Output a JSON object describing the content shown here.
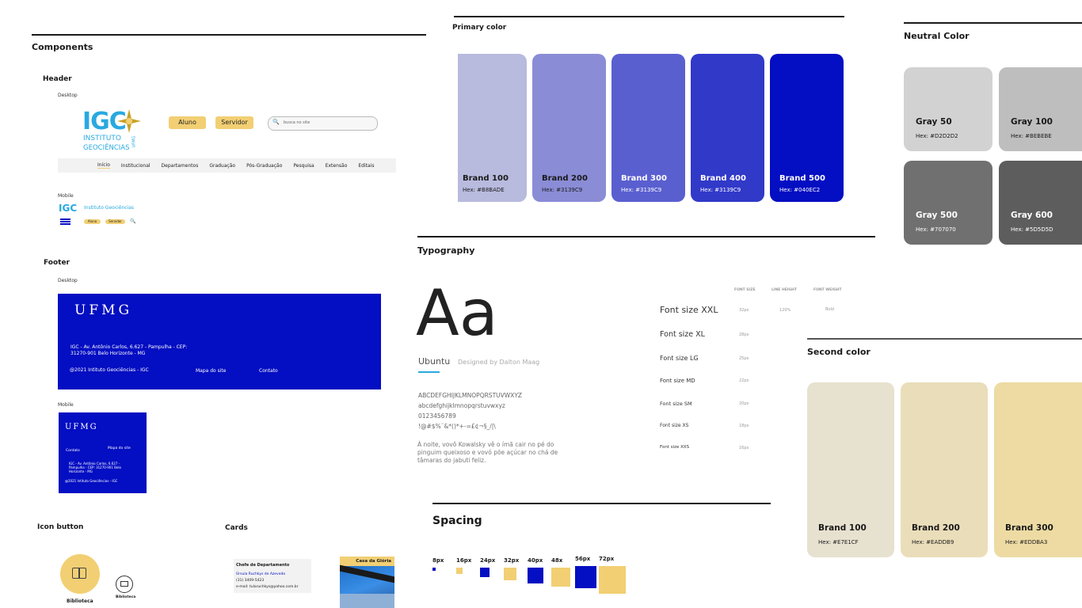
{
  "components": {
    "title": "Components",
    "header": {
      "title": "Header",
      "desktop_label": "Desktop",
      "mobile_label": "Mobile",
      "logo_lines": [
        "IGC",
        "INSTITUTO",
        "GEOCIÊNCIAS",
        "UFMG"
      ],
      "buttons": [
        "Aluno",
        "Servidor"
      ],
      "search_placeholder": "busca no site",
      "nav": [
        "Início",
        "Institucional",
        "Departamentos",
        "Graduação",
        "Pós-Graduação",
        "Pesquisa",
        "Extensão",
        "Editais"
      ],
      "mobile_title": "Instituto Geociências",
      "mobile_buttons": [
        "Aluno",
        "Servidor"
      ]
    },
    "footer": {
      "title": "Footer",
      "desktop_label": "Desktop",
      "mobile_label": "Mobile",
      "logo": "UFMG",
      "address": "IGC - Av. Antônio Carlos, 6.627 - Pampulha - CEP: 31270-901 Belo Horizonte - MG",
      "copyright": "@2021 Intituto Geociências - IGC",
      "link_map": "Mapa do site",
      "link_contact": "Contato",
      "mobile_contact": "Contato",
      "mobile_map": "Mapa do site",
      "mobile_address": "IGC - Av. Antônio Carlos, 6.627 - Pampulha - CEP: 31270-901 Belo Horizonte - MG",
      "mobile_copyright": "@2021 Intituto Geociências - IGC"
    },
    "icon_button": {
      "title": "Icon button",
      "large_label": "Biblioteca",
      "small_label": "Biblioteca"
    },
    "cards": {
      "title": "Cards",
      "card1_title": "Chefe de Departamento",
      "card1_name": "Úrsula Ruchkys de Azevedo",
      "card1_phone": "(31) 3409-5423",
      "card1_email": "e-mail: tularuchkys@yahoo.com.br",
      "card2_title": "Casa da Glória"
    }
  },
  "primary_color": {
    "title": "Primary color",
    "swatches": [
      {
        "name": "Brand 100",
        "hex_label": "Hex: #B8BADE",
        "color": "#B8BADE"
      },
      {
        "name": "Brand 200",
        "hex_label": "Hex: #3139C9",
        "color": "#8A8CD6"
      },
      {
        "name": "Brand 300",
        "hex_label": "Hex: #3139C9",
        "color": "#5A5FD0"
      },
      {
        "name": "Brand 400",
        "hex_label": "Hex: #3139C9",
        "color": "#3139C9"
      },
      {
        "name": "Brand 500",
        "hex_label": "Hex: #040EC2",
        "color": "#040EC2"
      }
    ]
  },
  "neutral_color": {
    "title": "Neutral Color",
    "swatches": [
      {
        "name": "Gray 50",
        "hex_label": "Hex: #D2D2D2",
        "color": "#D2D2D2"
      },
      {
        "name": "Gray 100",
        "hex_label": "Hex: #BEBEBE",
        "color": "#BEBEBE"
      },
      {
        "name": "Gray 500",
        "hex_label": "Hex: #707070",
        "color": "#707070"
      },
      {
        "name": "Gray 600",
        "hex_label": "Hex: #5D5D5D",
        "color": "#5D5D5D"
      }
    ]
  },
  "typography": {
    "title": "Typography",
    "sample_glyph": "Aa",
    "font_name": "Ubuntu",
    "designer": "Designed by Dalton Maag",
    "uppercase": "ABCDEFGHIJKLMNOPQRSTUVWXYZ",
    "lowercase": "abcdefghijklmnopqrstuvwxyz",
    "digits": "0123456789",
    "symbols": "!@#$%¨&*()*+-=£¢¬§_/|\\",
    "pangram": "À noite, vovô Kowalsky vê o ímã cair no pé do pinguim queixoso e vovó põe açúcar no chá de tâmaras do jabuti feliz.",
    "col_headers": [
      "FONT SIZE",
      "LINE HEIGHT",
      "FONT WEIGHT"
    ],
    "line_height": "120%",
    "font_weight": "Bold",
    "sizes": [
      {
        "name": "Font size XXL",
        "size": "32px"
      },
      {
        "name": "Font size XL",
        "size": "28px"
      },
      {
        "name": "Font size LG",
        "size": "25px"
      },
      {
        "name": "Font size MD",
        "size": "22px"
      },
      {
        "name": "Font size SM",
        "size": "20px"
      },
      {
        "name": "Font size XS",
        "size": "18px"
      },
      {
        "name": "Font size XXS",
        "size": "16px"
      }
    ]
  },
  "second_color": {
    "title": "Second color",
    "swatches": [
      {
        "name": "Brand 100",
        "hex_label": "Hex: #E7E1CF",
        "color": "#E7E1CF"
      },
      {
        "name": "Brand 200",
        "hex_label": "Hex: #EADDB9",
        "color": "#EADDB9"
      },
      {
        "name": "Brand 300",
        "hex_label": "Hex: #EDDBA3",
        "color": "#EDDBA3"
      }
    ]
  },
  "spacing": {
    "title": "Spacing",
    "items": [
      "8px",
      "16px",
      "24px",
      "32px",
      "40px",
      "48x",
      "56px",
      "72px"
    ],
    "blue": "#040EC2",
    "yellow": "#F2CF73"
  }
}
